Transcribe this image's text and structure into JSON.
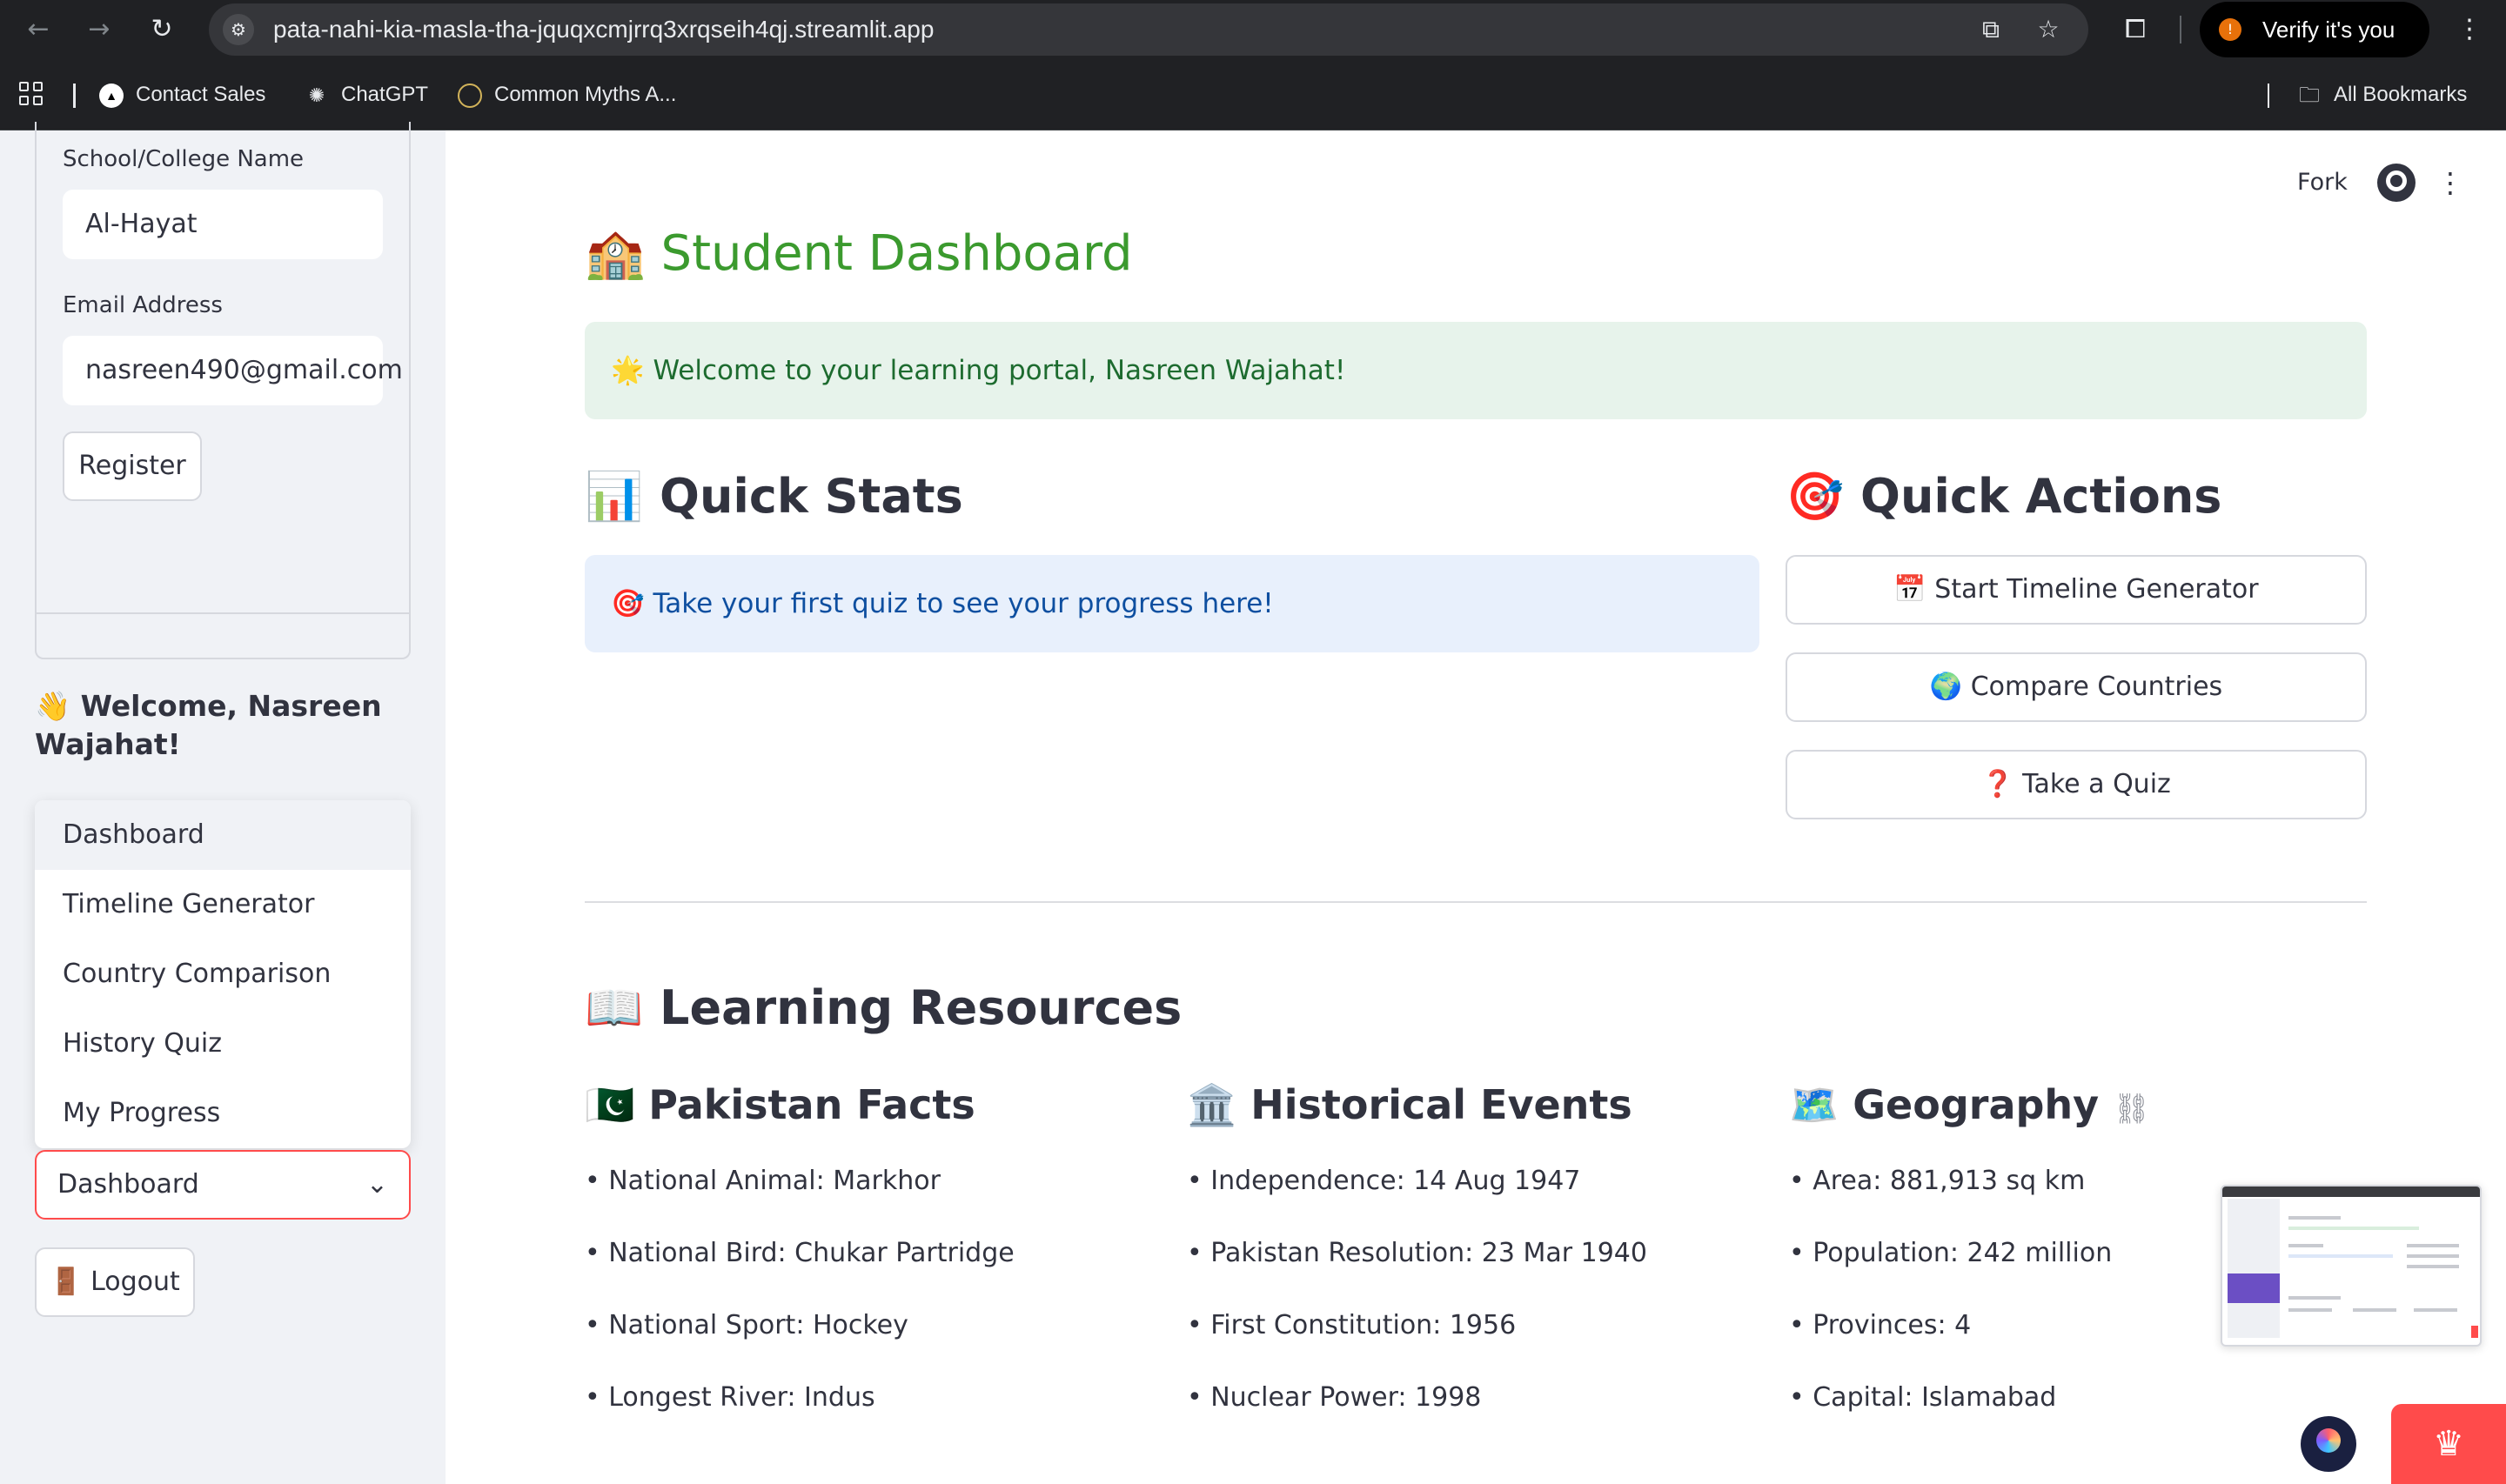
{
  "browser": {
    "url": "pata-nahi-kia-masla-tha-jquqxcmjrrq3xrqseih4qj.streamlit.app",
    "profile_label": "Verify it's you",
    "bookmarks": [
      {
        "label": "Contact Sales",
        "icon": "triangle-logo-icon"
      },
      {
        "label": "ChatGPT",
        "icon": "chatgpt-icon"
      },
      {
        "label": "Common Myths A...",
        "icon": "circle-icon"
      }
    ],
    "all_bookmarks_label": "All Bookmarks"
  },
  "sidebar": {
    "school_label": "School/College Name",
    "school_value": "Al-Hayat",
    "email_label": "Email Address",
    "email_value": "nasreen490@gmail.com",
    "register_label": "Register",
    "welcome_text": "👋 Welcome, Nasreen Wajahat!",
    "menu_items": [
      "Dashboard",
      "Timeline Generator",
      "Country Comparison",
      "History Quiz",
      "My Progress"
    ],
    "selected_page": "Dashboard",
    "logout_label": "🚪 Logout"
  },
  "toolbar": {
    "fork_label": "Fork"
  },
  "main": {
    "title": "🏫 Student Dashboard",
    "welcome_message": "🌟 Welcome to your learning portal, Nasreen Wajahat!",
    "quick_stats_heading": "📊 Quick Stats",
    "quick_stats_info": "🎯 Take your first quiz to see your progress here!",
    "quick_actions_heading": "🎯 Quick Actions",
    "quick_actions": [
      "📅 Start Timeline Generator",
      "🌍 Compare Countries",
      "❓ Take a Quiz"
    ],
    "resources_heading": "📖 Learning Resources",
    "columns": [
      {
        "heading": "🇵🇰 Pakistan Facts",
        "items": [
          "• National Animal: Markhor",
          "• National Bird: Chukar Partridge",
          "• National Sport: Hockey",
          "• Longest River: Indus"
        ]
      },
      {
        "heading": "🏛️ Historical Events",
        "items": [
          "• Independence: 14 Aug 1947",
          "• Pakistan Resolution: 23 Mar 1940",
          "• First Constitution: 1956",
          "• Nuclear Power: 1998"
        ]
      },
      {
        "heading": "🗺️ Geography",
        "items": [
          "• Area: 881,913 sq km",
          "• Population: 242 million",
          "• Provinces: 4",
          "• Capital: Islamabad"
        ]
      }
    ]
  },
  "colors": {
    "title_green": "#3b9a2e",
    "success_bg": "#e7f3eb",
    "info_bg": "#e8f0fc",
    "accent_red": "#ff4b4b"
  }
}
